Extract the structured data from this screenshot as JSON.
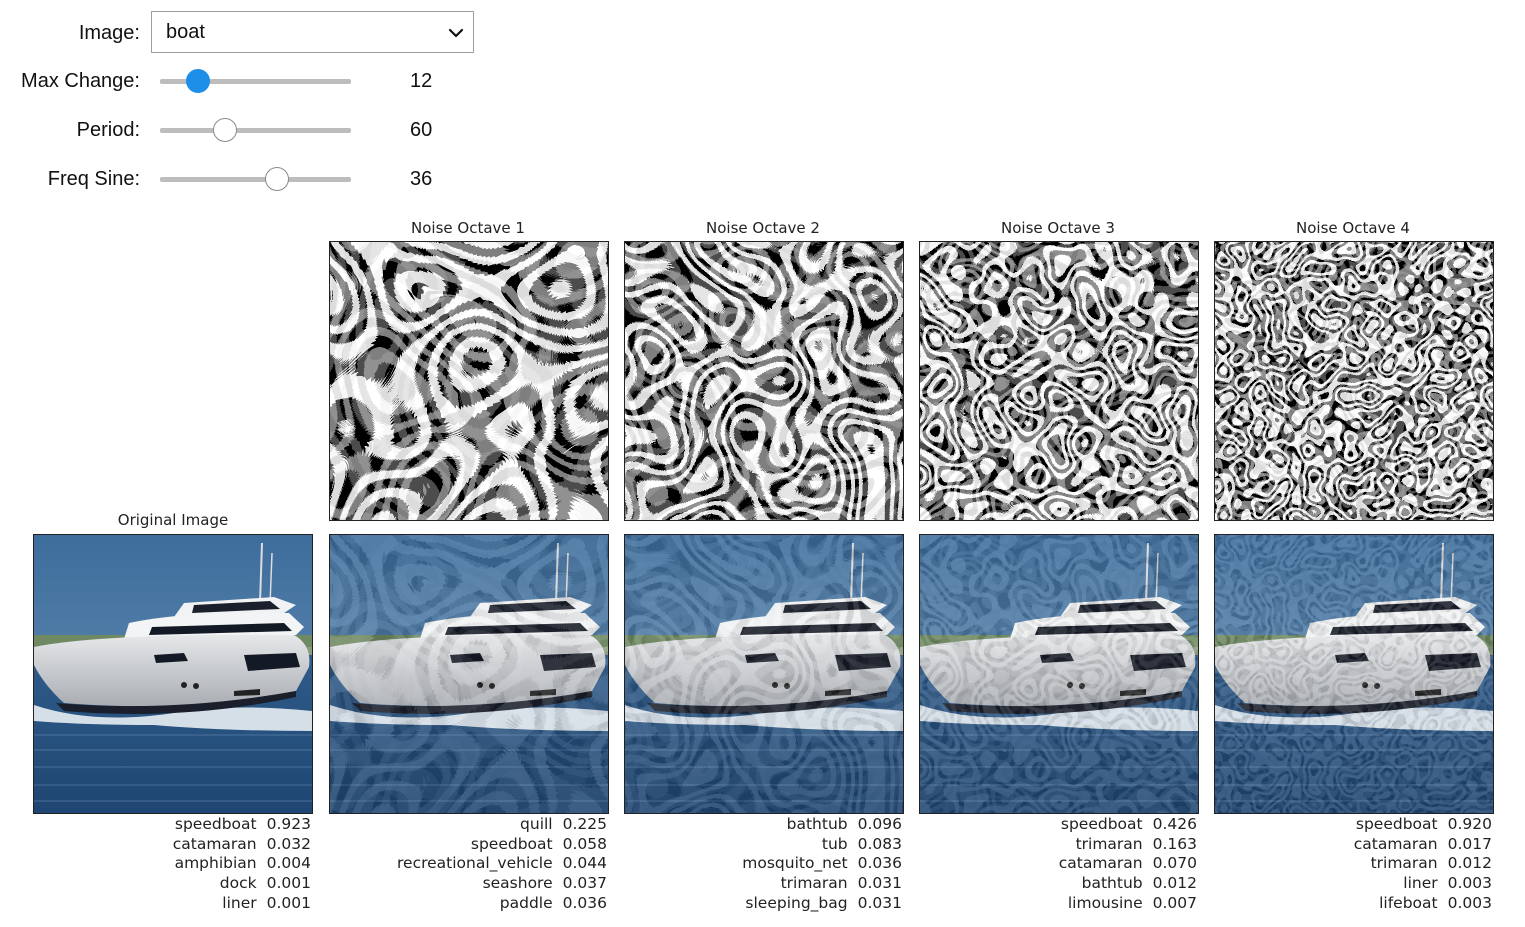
{
  "controls": {
    "image": {
      "label": "Image:",
      "value": "boat"
    },
    "max_change": {
      "label": "Max Change:",
      "value": "12",
      "level": 0.2
    },
    "period": {
      "label": "Period:",
      "value": "60",
      "level": 0.34
    },
    "freq_sine": {
      "label": "Freq Sine:",
      "value": "36",
      "level": 0.61
    }
  },
  "colors": {
    "accent": "#1e8fe8",
    "sky": "#3f6f9e",
    "water": "#2a5584"
  },
  "panels": {
    "original": {
      "title": "Original Image",
      "predictions": [
        {
          "label": "speedboat",
          "score": "0.923"
        },
        {
          "label": "catamaran",
          "score": "0.032"
        },
        {
          "label": "amphibian",
          "score": "0.004"
        },
        {
          "label": "dock",
          "score": "0.001"
        },
        {
          "label": "liner",
          "score": "0.001"
        }
      ]
    },
    "octaves": [
      {
        "title": "Noise Octave 1",
        "predictions": [
          {
            "label": "quill",
            "score": "0.225"
          },
          {
            "label": "speedboat",
            "score": "0.058"
          },
          {
            "label": "recreational_vehicle",
            "score": "0.044"
          },
          {
            "label": "seashore",
            "score": "0.037"
          },
          {
            "label": "paddle",
            "score": "0.036"
          }
        ]
      },
      {
        "title": "Noise Octave 2",
        "predictions": [
          {
            "label": "bathtub",
            "score": "0.096"
          },
          {
            "label": "tub",
            "score": "0.083"
          },
          {
            "label": "mosquito_net",
            "score": "0.036"
          },
          {
            "label": "trimaran",
            "score": "0.031"
          },
          {
            "label": "sleeping_bag",
            "score": "0.031"
          }
        ]
      },
      {
        "title": "Noise Octave 3",
        "predictions": [
          {
            "label": "speedboat",
            "score": "0.426"
          },
          {
            "label": "trimaran",
            "score": "0.163"
          },
          {
            "label": "catamaran",
            "score": "0.070"
          },
          {
            "label": "bathtub",
            "score": "0.012"
          },
          {
            "label": "limousine",
            "score": "0.007"
          }
        ]
      },
      {
        "title": "Noise Octave 4",
        "predictions": [
          {
            "label": "speedboat",
            "score": "0.920"
          },
          {
            "label": "catamaran",
            "score": "0.017"
          },
          {
            "label": "trimaran",
            "score": "0.012"
          },
          {
            "label": "liner",
            "score": "0.003"
          },
          {
            "label": "lifeboat",
            "score": "0.003"
          }
        ]
      }
    ]
  }
}
